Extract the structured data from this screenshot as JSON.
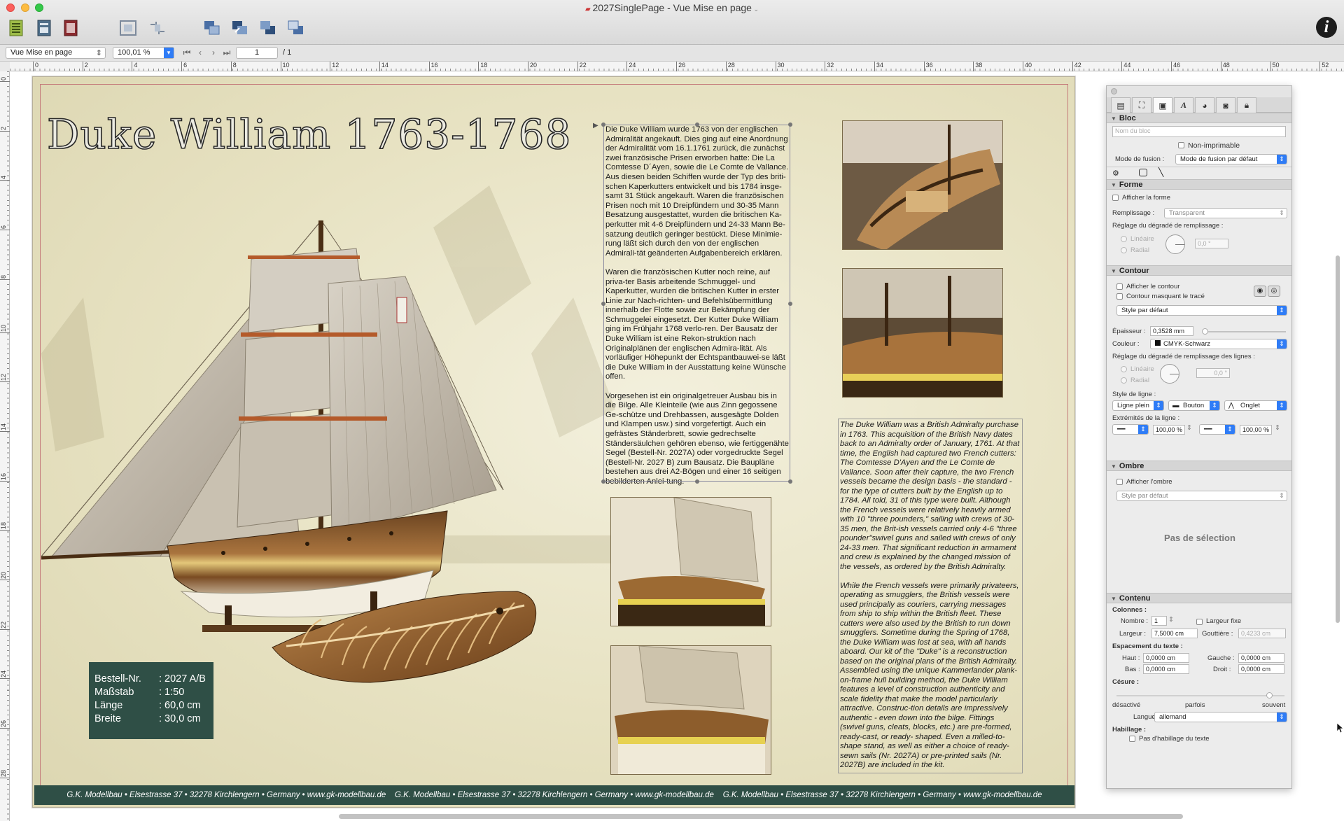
{
  "window": {
    "title": "2027SinglePage - Vue Mise en page",
    "info_label": "i"
  },
  "toolbar": {
    "icons": [
      "page-layout-icon",
      "master-page-icon",
      "book-icon",
      "group-icon",
      "ungroup-icon",
      "bring-front-icon",
      "bring-forward-icon",
      "send-backward-icon",
      "send-back-icon"
    ]
  },
  "navbar": {
    "view_select": "Vue Mise en page",
    "zoom": "100,01 %",
    "page_number": "1",
    "page_total": "/ 1"
  },
  "ruler": {
    "h_labels": [
      "0",
      "2",
      "4",
      "6",
      "8",
      "10",
      "12",
      "14",
      "16",
      "18",
      "20",
      "22",
      "24",
      "26",
      "28",
      "30",
      "32",
      "34",
      "36",
      "38",
      "40",
      "42",
      "44",
      "46",
      "48",
      "50",
      "52"
    ],
    "v_labels": [
      "0",
      "2",
      "4",
      "6",
      "8",
      "10",
      "12",
      "14",
      "16",
      "18",
      "20",
      "22",
      "24",
      "26",
      "28"
    ]
  },
  "document": {
    "title": "Duke William 1763-1768",
    "specs": [
      {
        "label": "Bestell-Nr.",
        "value": ": 2027 A/B"
      },
      {
        "label": "Maßstab",
        "value": ": 1:50"
      },
      {
        "label": "Länge",
        "value": ": 60,0 cm"
      },
      {
        "label": "Breite",
        "value": ": 30,0 cm"
      }
    ],
    "german_text": [
      "Die Duke William wurde 1763 von der englischen Admiralität angekauft. Dies ging auf eine Anordnung der Admiralität vom 16.1.1761 zurück, die zunächst zwei französische Prisen erworben hatte: Die La Comtesse D´Ayen, sowie die Le Comte de Vallance. Aus diesen beiden Schiffen wurde der Typ des briti-schen Kaperkutters entwickelt und bis 1784 insge-samt 31 Stück angekauft. Waren die französischen Prisen noch mit 10 Dreipfündern und 30-35 Mann Besatzung ausgestattet, wurden die britischen Ka-perkutter mit 4-6 Dreipfündern und 24-33 Mann Be-satzung deutlich geringer bestückt. Diese Minimie-rung läßt sich durch den von der englischen Admirali-tät geänderten Aufgabenbereich erklären.",
      "Waren die französischen Kutter noch reine, auf priva-ter Basis arbeitende Schmuggel- und Kaperkutter, wurden die britischen Kutter in erster Linie zur Nach-richten- und Befehlsübermittlung innerhalb der Flotte sowie zur Bekämpfung der Schmuggelei eingesetzt. Der Kutter Duke William ging im Frühjahr 1768 verlo-ren. Der Bausatz der Duke William ist eine Rekon-struktion nach Originalplänen der englischen Admira-lität. Als vorläufiger Höhepunkt der Echtspantbauwei-se läßt die Duke William in der Ausstattung keine Wünsche offen.",
      "Vorgesehen ist ein originalgetreuer Ausbau bis in die Bilge. Alle Kleinteile (wie aus Zinn gegossene Ge-schütze und Drehbassen, ausgesägte Dolden und Klampen usw.) sind vorgefertigt. Auch ein gefrästes Ständerbrett, sowie gedrechselte Ständersäulchen gehören ebenso, wie fertiggenähte Segel (Bestell-Nr. 2027A) oder vorgedruckte Segel (Bestell-Nr. 2027 B) zum Bausatz. Die Baupläne bestehen aus drei A2-Bögen und einer 16 seitigen bebilderten Anlei-tung."
    ],
    "english_text": [
      "The Duke William was a British Admiralty purchase in 1763. This acquisition of the British Navy dates back to an Admiralty order of January, 1761. At that time, the English had captured two French cutters: The Comtesse D'Ayen and the Le Comte de Vallance. Soon after their capture, the two French vessels became the design basis - the standard - for the type of cutters built by the English up to 1784. All told, 31 of this type were built. Although the French vessels were relatively heavily armed with 10 \"three pounders,\" sailing with crews of 30-35 men, the Brit-ish vessels carried only 4-6 \"three pounder\"swivel guns and sailed with crews of only 24-33 men. That significant reduction in armament and crew is explained by the changed mission of the vessels, as ordered by the British Admiralty.",
      "While the French vessels were primarily privateers, operating as smugglers, the British vessels were used principally as couriers, carrying messages from ship to ship within the British fleet. These cutters were also used by the British to run down smugglers. Sometime during the Spring of 1768, the Duke William was lost at sea, with all hands aboard. Our kit of the \"Duke\" is a reconstruction based on the original plans of the British Admiralty. Assembled using the unique Kammerlander plank-on-frame hull building method, the Duke William features a level of construction authenticity and scale fidelity that make the model particularly attractive. Construc-tion details are impressively authentic - even down into the bilge. Fittings (swivel guns, cleats, blocks, etc.) are pre-formed, ready-cast, or ready- shaped. Even a milled-to-shape stand, as well as either a choice of ready-sewn sails (Nr. 2027A) or pre-printed sails (Nr. 2027B) are included in the kit."
    ],
    "footer_items": [
      "G.K. Modellbau • Elsestrasse 37 • 32278 Kirchlengern • Germany • www.gk-modellbau.de",
      "G.K. Modellbau • Elsestrasse 37 • 32278 Kirchlengern • Germany • www.gk-modellbau.de",
      "G.K. Modellbau • Elsestrasse 37 • 32278 Kirchlengern • Germany • www.gk-modellbau.de"
    ]
  },
  "inspector": {
    "tabs": [
      "document-tab-icon",
      "geometry-tab-icon",
      "block-tab-icon",
      "text-tab-icon",
      "color-tab-icon",
      "image-tab-icon",
      "lock-tab-icon"
    ],
    "bloc": {
      "header": "Bloc",
      "name_placeholder": "Nom du bloc",
      "non_printable": "Non-imprimable",
      "blend_label": "Mode de fusion :",
      "blend_value": "Mode de fusion par défaut"
    },
    "forme": {
      "header": "Forme",
      "show_shape": "Afficher la forme",
      "fill_label": "Remplissage :",
      "fill_value": "Transparent",
      "gradient_label": "Réglage du dégradé de remplissage :",
      "linear": "Linéaire",
      "radial": "Radial",
      "angle": "0,0 °"
    },
    "contour": {
      "header": "Contour",
      "show_contour": "Afficher le contour",
      "mask_contour": "Contour masquant le tracé",
      "style_value": "Style par défaut",
      "thickness_label": "Épaisseur :",
      "thickness_value": "0,3528 mm",
      "color_label": "Couleur :",
      "color_value": "CMYK-Schwarz",
      "line_gradient_label": "Réglage du dégradé de remplissage des lignes :",
      "linear": "Linéaire",
      "radial": "Radial",
      "angle": "0,0 °",
      "line_style_label": "Style de ligne :",
      "line_style": "Ligne plein",
      "cap_style": "Bouton",
      "join_style": "Onglet",
      "ends_label": "Extrémités de la ligne :",
      "start_scale": "100,00 %",
      "end_scale": "100,00 %"
    },
    "ombre": {
      "header": "Ombre",
      "show_shadow": "Afficher l'ombre",
      "style_value": "Style par défaut",
      "no_selection": "Pas de sélection"
    },
    "contenu": {
      "header": "Contenu",
      "columns_label": "Colonnes :",
      "number_label": "Nombre :",
      "number_value": "1",
      "fixed_width": "Largeur fixe",
      "width_label": "Largeur :",
      "width_value": "7,5000 cm",
      "gutter_label": "Gouttière :",
      "gutter_value": "0,4233 cm",
      "spacing_label": "Espacement du texte :",
      "top_label": "Haut :",
      "top_value": "0,0000 cm",
      "left_label": "Gauche :",
      "left_value": "0,0000 cm",
      "bottom_label": "Bas :",
      "bottom_value": "0,0000 cm",
      "right_label": "Droit :",
      "right_value": "0,0000 cm",
      "hyphen_label": "Césure :",
      "hyphen_off": "désactivé",
      "hyphen_sometimes": "parfois",
      "hyphen_often": "souvent",
      "language_label": "Langue :",
      "language_value": "allemand",
      "wrap_label": "Habillage :",
      "no_wrap": "Pas d'habillage du texte"
    }
  }
}
